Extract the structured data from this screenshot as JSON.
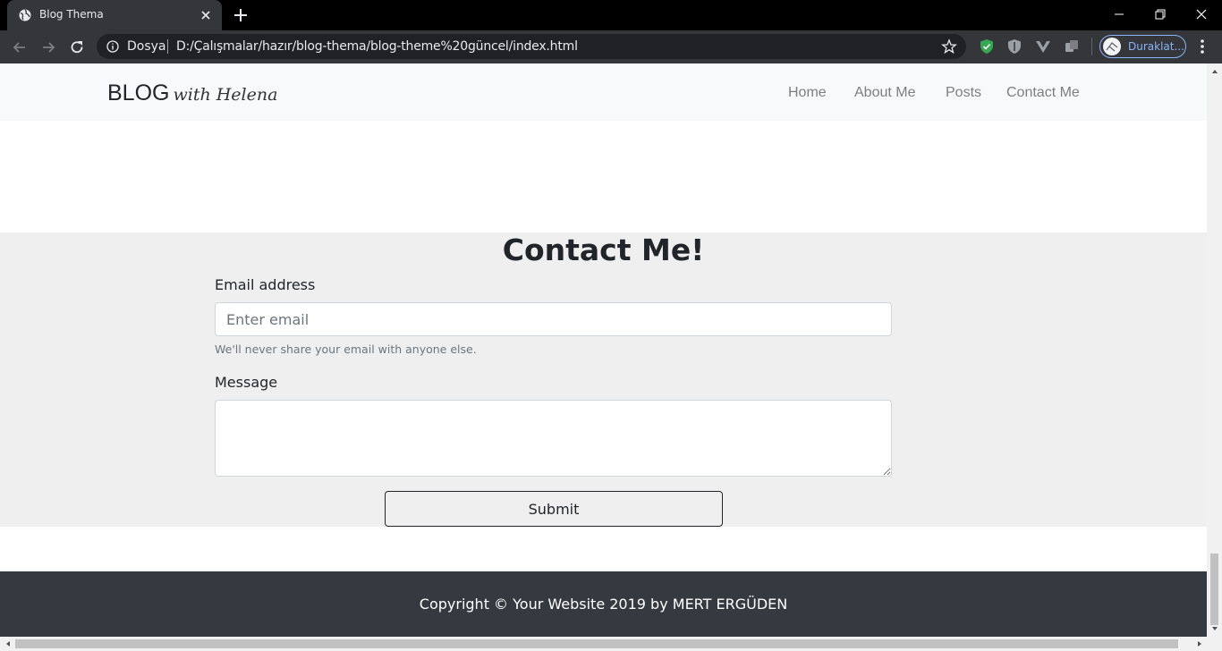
{
  "browser": {
    "tab_title": "Blog Thema",
    "omnibox": {
      "scheme_label": "Dosya",
      "url": "D:/Çalışmalar/hazır/blog-thema/blog-theme%20güncel/index.html"
    },
    "profile_label": "Duraklat..."
  },
  "navbar": {
    "brand": "BLOG",
    "brand_script": "with Helena",
    "links": [
      "Home",
      "About Me",
      "Posts",
      "Contact Me"
    ]
  },
  "contact": {
    "title": "Contact Me!",
    "email_label": "Email address",
    "email_placeholder": "Enter email",
    "email_help": "We'll never share your email with anyone else.",
    "message_label": "Message",
    "submit_label": "Submit"
  },
  "footer": {
    "copyright": "Copyright © Your Website 2019 by MERT ERGÜDEN"
  },
  "colors": {
    "navbar_bg": "#f8f9fa",
    "section_bg": "#efefef",
    "footer_bg": "#343a40",
    "chrome_dark": "#35363a",
    "accent": "#8ab4f8"
  }
}
